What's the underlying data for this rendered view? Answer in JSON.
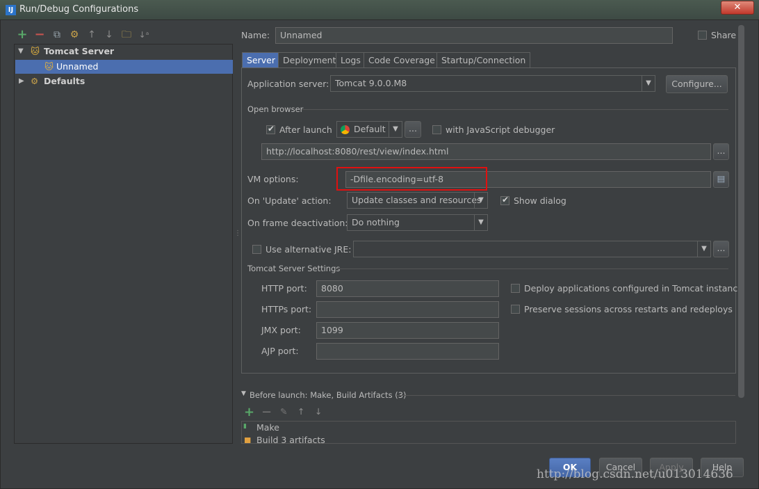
{
  "window": {
    "title": "Run/Debug Configurations",
    "close": "✕"
  },
  "toolbar": {
    "add": "+",
    "remove": "−",
    "copy": "⧉",
    "edit_defaults": "⚙",
    "up": "↑",
    "down": "↓",
    "folder": "🗀",
    "sort": "↓ᵃ"
  },
  "tree": {
    "tomcat_server": "Tomcat Server",
    "unnamed": "Unnamed",
    "defaults": "Defaults"
  },
  "name_label": "Name:",
  "name_value": "Unnamed",
  "share_label": "Share",
  "tabs": [
    "Server",
    "Deployment",
    "Logs",
    "Code Coverage",
    "Startup/Connection"
  ],
  "server": {
    "app_server_label": "Application server:",
    "app_server_value": "Tomcat 9.0.0.M8",
    "configure": "Configure...",
    "open_browser": "Open browser",
    "after_launch": "After launch",
    "browser": "Default",
    "ellipsis": "...",
    "js_debugger": "with JavaScript debugger",
    "url": "http://localhost:8080/rest/view/index.html",
    "vm_label": "VM options:",
    "vm_value": "-Dfile.encoding=utf-8",
    "update_label": "On 'Update' action:",
    "update_value": "Update classes and resources",
    "show_dialog": "Show dialog",
    "frame_label": "On frame deactivation:",
    "frame_value": "Do nothing",
    "alt_jre": "Use alternative JRE:",
    "tomcat_settings": "Tomcat Server Settings",
    "http_label": "HTTP port:",
    "http_value": "8080",
    "https_label": "HTTPs port:",
    "https_value": "",
    "jmx_label": "JMX port:",
    "jmx_value": "1099",
    "ajp_label": "AJP port:",
    "ajp_value": "",
    "deploy_apps": "Deploy applications configured in Tomcat instance",
    "preserve": "Preserve sessions across restarts and redeploys"
  },
  "before_launch": {
    "title": "Before launch: Make, Build Artifacts (3)",
    "items": [
      "Make",
      "Build 3 artifacts"
    ]
  },
  "buttons": {
    "ok": "OK",
    "cancel": "Cancel",
    "apply": "Apply",
    "help": "Help"
  },
  "watermark": "http://blog.csdn.net/u013014636",
  "colors": {
    "accent": "#4b6eaf",
    "highlight_box": "#e01010",
    "add": "#59a869",
    "remove": "#c75450"
  }
}
